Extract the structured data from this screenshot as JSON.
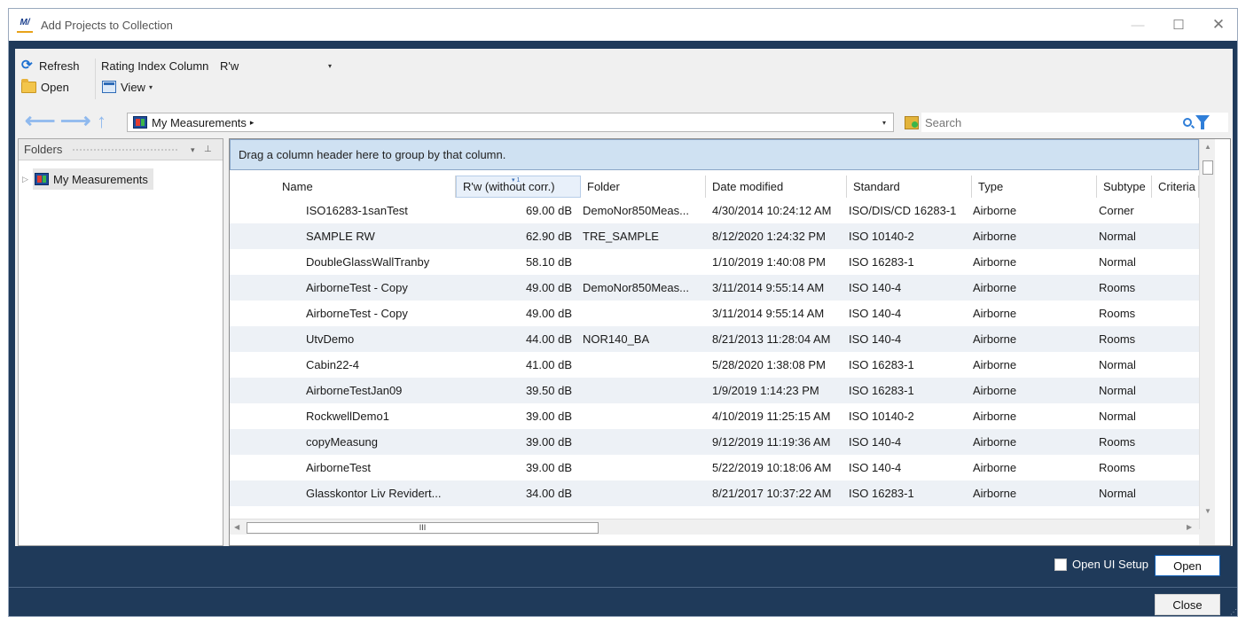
{
  "window": {
    "title": "Add Projects to Collection",
    "logo_text": "M/",
    "min_label": "—",
    "max_label": "☐",
    "close_label": "✕"
  },
  "toolbar": {
    "refresh_label": "Refresh",
    "open_label": "Open",
    "rating_label": "Rating Index Column",
    "rating_value": "R'w",
    "view_label": "View",
    "dropdown_glyph": "▾"
  },
  "nav": {
    "back_glyph": "⟵",
    "forward_glyph": "⟶",
    "up_glyph": "↑",
    "address_text": "My Measurements",
    "address_chevron": "▸",
    "search_placeholder": "Search"
  },
  "folders": {
    "header": "Folders",
    "tree": [
      {
        "label": "My Measurements",
        "expander": "▷"
      }
    ],
    "pin_glyph": "⊥",
    "menu_glyph": "▾"
  },
  "grid": {
    "group_hint": "Drag a column header here to group by that column.",
    "sort_marker": "▾ 1",
    "columns": [
      "Name",
      "R'w (without corr.)",
      "Folder",
      "Date modified",
      "Standard",
      "Type",
      "Subtype",
      "Criteria"
    ],
    "rows": [
      [
        "ISO16283-1sanTest",
        "69.00 dB",
        "DemoNor850Meas...",
        "4/30/2014 10:24:12 AM",
        "ISO/DIS/CD 16283-1",
        "Airborne",
        "Corner"
      ],
      [
        "SAMPLE RW",
        "62.90 dB",
        "TRE_SAMPLE",
        "8/12/2020 1:24:32 PM",
        "ISO 10140-2",
        "Airborne",
        "Normal"
      ],
      [
        "DoubleGlassWallTranby",
        "58.10 dB",
        "",
        "1/10/2019 1:40:08 PM",
        "ISO 16283-1",
        "Airborne",
        "Normal"
      ],
      [
        "AirborneTest - Copy",
        "49.00 dB",
        "DemoNor850Meas...",
        "3/11/2014 9:55:14 AM",
        "ISO 140-4",
        "Airborne",
        "Rooms"
      ],
      [
        "AirborneTest - Copy",
        "49.00 dB",
        "",
        "3/11/2014 9:55:14 AM",
        "ISO 140-4",
        "Airborne",
        "Rooms"
      ],
      [
        "UtvDemo",
        "44.00 dB",
        "NOR140_BA",
        "8/21/2013 11:28:04 AM",
        "ISO 140-4",
        "Airborne",
        "Rooms"
      ],
      [
        "Cabin22-4",
        "41.00 dB",
        "",
        "5/28/2020 1:38:08 PM",
        "ISO 16283-1",
        "Airborne",
        "Normal"
      ],
      [
        "AirborneTestJan09",
        "39.50 dB",
        "",
        "1/9/2019 1:14:23 PM",
        "ISO 16283-1",
        "Airborne",
        "Normal"
      ],
      [
        "RockwellDemo1",
        "39.00 dB",
        "",
        "4/10/2019 11:25:15 AM",
        "ISO 10140-2",
        "Airborne",
        "Normal"
      ],
      [
        "copyMeasung",
        "39.00 dB",
        "",
        "9/12/2019 11:19:36 AM",
        "ISO 140-4",
        "Airborne",
        "Rooms"
      ],
      [
        "AirborneTest",
        "39.00 dB",
        "",
        "5/22/2019 10:18:06 AM",
        "ISO 140-4",
        "Airborne",
        "Rooms"
      ],
      [
        "Glasskontor Liv Revidert...",
        "34.00 dB",
        "",
        "8/21/2017 10:37:22 AM",
        "ISO 16283-1",
        "Airborne",
        "Normal"
      ]
    ],
    "scroll_thumb_label": "III",
    "scroll_up": "▲",
    "scroll_down": "▼",
    "scroll_left": "◀",
    "scroll_right": "▶"
  },
  "footer": {
    "open_ui_setup_label": "Open UI Setup",
    "open_button": "Open",
    "close_button": "Close",
    "grip_glyph": "⋰"
  },
  "colors": {
    "window_frame": "#1f3a5a",
    "group_area": "#cfe1f2",
    "accent_blue": "#2f7ed8"
  }
}
